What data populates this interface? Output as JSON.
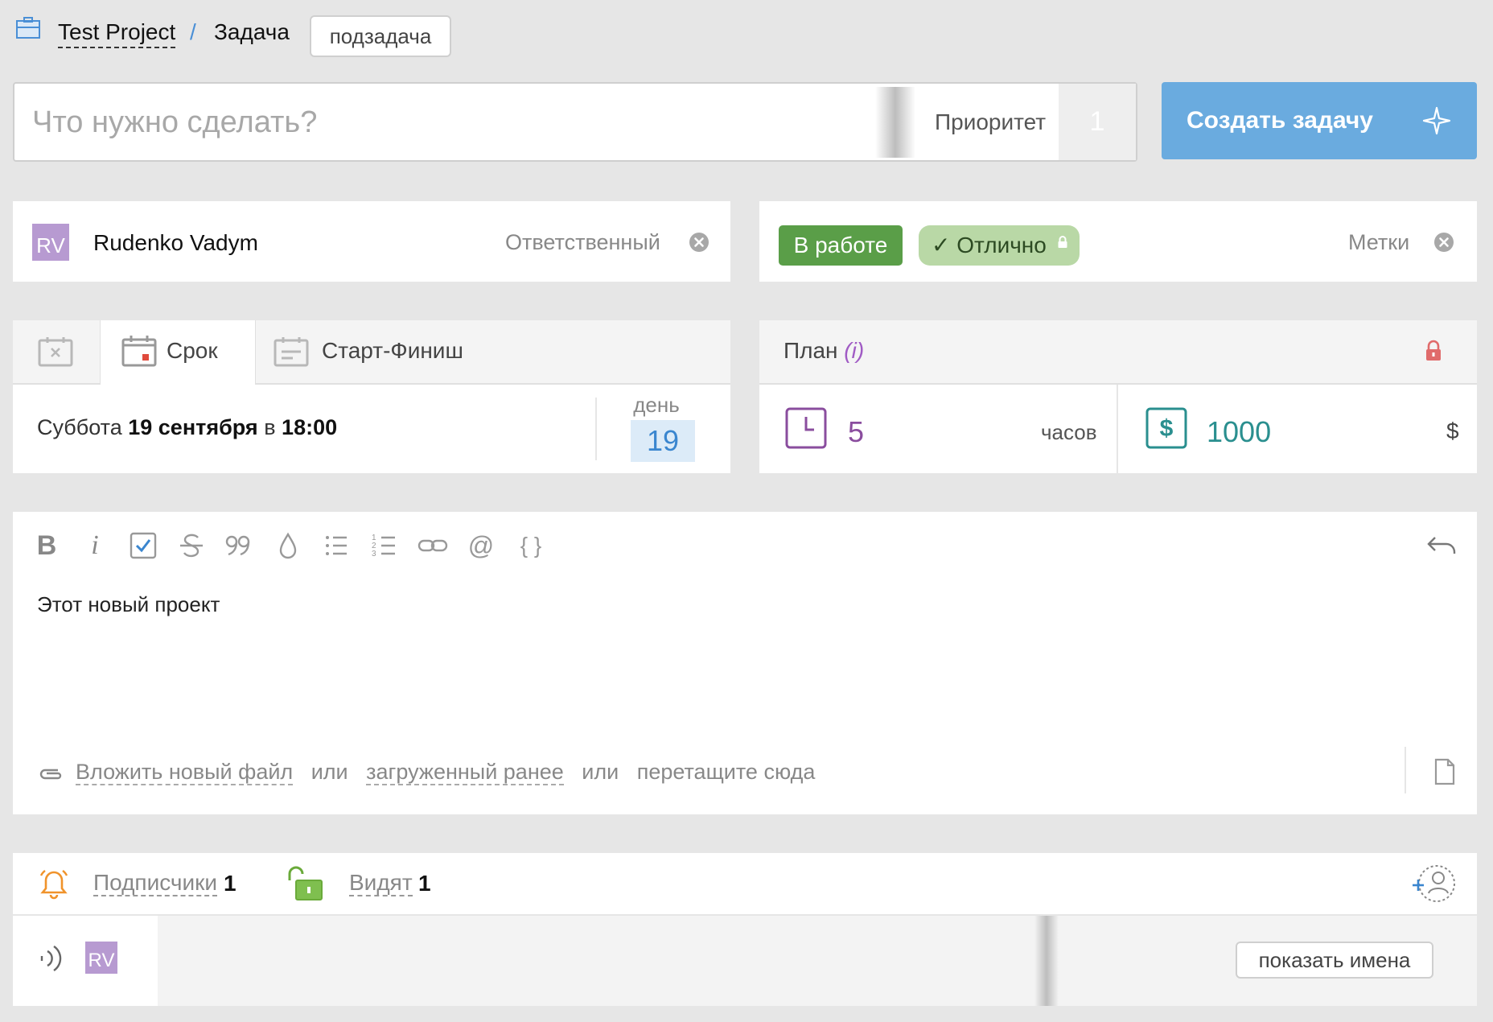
{
  "breadcrumb": {
    "project": "Test Project",
    "separator": "/",
    "current": "Задача",
    "subtask_button": "подзадача"
  },
  "task_input": {
    "placeholder": "Что нужно сделать?",
    "value": "",
    "priority_label": "Приоритет",
    "priority_value": "1"
  },
  "create_button": {
    "label": "Создать задачу",
    "color": "#6aabdf"
  },
  "responsible": {
    "avatar_initials": "RV",
    "name": "Rudenko Vadym",
    "label": "Ответственный"
  },
  "tags": {
    "items": [
      {
        "label": "В работе",
        "color": "#5a9e48"
      },
      {
        "label": "✓ Отлично",
        "color": "#b9d8a6"
      }
    ],
    "label": "Метки"
  },
  "dates": {
    "tabs": [
      {
        "label": ""
      },
      {
        "label": "Срок"
      },
      {
        "label": "Старт-Финиш"
      }
    ],
    "active_tab": "Срок",
    "weekday": "Суббота",
    "date": "19 сентября",
    "at": "в",
    "time": "18:00",
    "day_label": "день",
    "day_number": "19"
  },
  "plan": {
    "title": "План",
    "info_marker": "(i)",
    "hours_value": "5",
    "hours_unit": "часов",
    "money_value": "1000",
    "money_unit": "$"
  },
  "editor": {
    "toolbar_icons": [
      "bold-icon",
      "italic-icon",
      "checkbox-icon",
      "strikethrough-icon",
      "quote-icon",
      "color-drop-icon",
      "bullet-list-icon",
      "numbered-list-icon",
      "link-icon",
      "mention-icon",
      "code-braces-icon",
      "undo-icon"
    ],
    "bold_glyph": "B",
    "italic_glyph": "i",
    "mention_glyph": "@",
    "code_glyph": "{ }",
    "content": "Этот новый проект",
    "attach_new": "Вложить новый файл",
    "or1": "или",
    "attach_existing": "загруженный ранее",
    "or2": "или",
    "drag_here": "перетащите сюда"
  },
  "subscribers": {
    "subs_label": "Подписчики",
    "subs_count": "1",
    "visible_label": "Видят",
    "visible_count": "1",
    "avatar_initials": "RV",
    "show_names": "показать имена"
  }
}
